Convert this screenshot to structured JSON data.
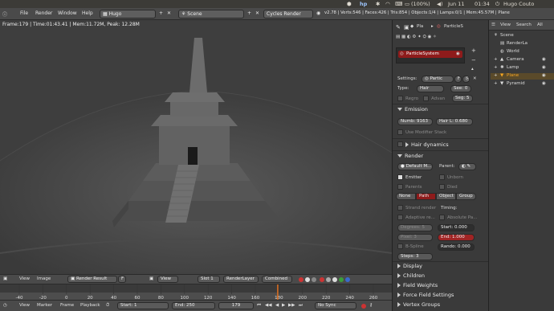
{
  "system_panel": {
    "battery": "(100%)",
    "date": "Jun 11",
    "time": "01:34",
    "user": "Hugo Couto"
  },
  "info_header": {
    "menus": [
      "File",
      "Render",
      "Window",
      "Help"
    ],
    "screen": "Hugo",
    "scene": "Scene",
    "engine": "Cycles Render",
    "stats": "v2.78 | Verts:546 | Faces:426 | Tris:854 | Objects:1/4 | Lamps:0/1 | Mem:45.57M | Plane"
  },
  "viewport": {
    "render_stats": "Frame:179 | Time:01:43.41 | Mem:11.72M, Peak: 12.28M"
  },
  "properties": {
    "tabs": [
      "Pla",
      "ParticleS"
    ],
    "particle_system_name": "ParticleSystem",
    "settings_label": "Settings:",
    "settings_value": "Partic",
    "settings_f": "F",
    "type_label": "Type:",
    "type_value": "Hair",
    "seed_label": "See: 0",
    "regrow_label": "Regro",
    "advanced_label": "Advan",
    "segments_label": "Seg: 5",
    "emission_header": "Emission",
    "number_field": "Numb: 9163",
    "hair_length_field": "Hair L: 0.680",
    "use_modifier_stack": "Use Modifier Stack",
    "hair_dynamics": "Hair dynamics",
    "render_header": "Render",
    "material_field": "Default M...",
    "parent_label": "Parent:",
    "emitter_label": "Emitter",
    "unborn_label": "Unborn",
    "parents_label": "Parents",
    "died_label": "Died",
    "render_types": [
      "None",
      "Path",
      "Object",
      "Group"
    ],
    "render_type_active": "Path",
    "strand_render": "Strand render",
    "timing_label": "Timing:",
    "adaptive_render": "Adaptive re...",
    "absolute_path": "Absolute Pa...",
    "degrees_field": "Degrees: 5",
    "start_field": "Start: 0.000",
    "pixel_field": "Pixel: 3",
    "end_field": "End: 1.000",
    "bspline_label": "B-Spline",
    "random_field": "Rando: 0.000",
    "steps_field": "Steps: 3",
    "collapsed_sections": [
      "Display",
      "Children",
      "Field Weights",
      "Force Field Settings",
      "Vertex Groups"
    ]
  },
  "outliner": {
    "menus": [
      "View",
      "Search",
      "All"
    ],
    "items": [
      "Scene",
      "RenderLa",
      "World",
      "Camera",
      "Lamp",
      "Plane",
      "Pyramid"
    ],
    "selected": "Plane"
  },
  "image_header": {
    "view": "View",
    "image": "Image",
    "image_name": "Render Result",
    "image_f": "F",
    "view2": "View",
    "slot": "Slot 1",
    "layer": "RenderLayer",
    "pass": "Combined"
  },
  "timeline": {
    "ticks": [
      "-40",
      "-20",
      "0",
      "20",
      "40",
      "60",
      "80",
      "100",
      "120",
      "140",
      "160",
      "180",
      "200",
      "220",
      "240",
      "260"
    ],
    "current_frame": 179
  },
  "timeline_header": {
    "menus": [
      "View",
      "Marker",
      "Frame",
      "Playback"
    ],
    "start_field": "Start: 1",
    "end_field": "End: 250",
    "current_field": "179",
    "sync": "No Sync"
  },
  "colors": {
    "accent_red": "#8e1b1b",
    "active_red": "#c03030",
    "ubuntu_panel": "#3c3b37",
    "playhead": "#e07020"
  }
}
